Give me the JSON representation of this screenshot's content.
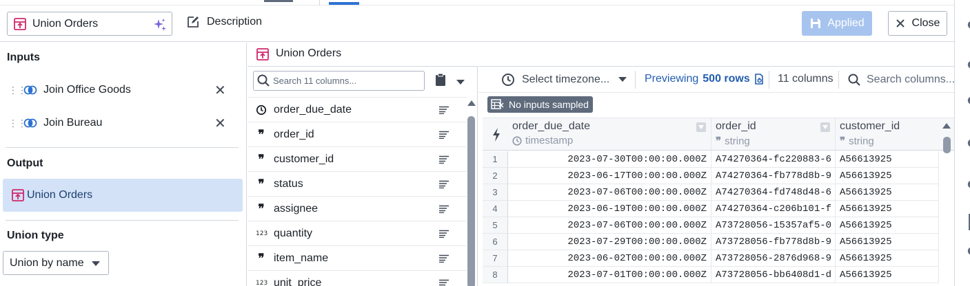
{
  "header": {
    "transform_name": "Union Orders",
    "description_label": "Description",
    "applied_label": "Applied",
    "close_label": "Close"
  },
  "left_panel": {
    "inputs_title": "Inputs",
    "inputs": [
      {
        "label": "Join Office Goods"
      },
      {
        "label": "Join Bureau"
      }
    ],
    "output_title": "Output",
    "output": {
      "label": "Union Orders"
    },
    "union_type_title": "Union type",
    "union_type_value": "Union by name"
  },
  "columns_panel": {
    "title": "Union Orders",
    "search_placeholder": "Search 11 columns...",
    "columns": [
      {
        "name": "order_due_date",
        "type_icon": "clock-icon"
      },
      {
        "name": "order_id",
        "type_icon": "quote-icon"
      },
      {
        "name": "customer_id",
        "type_icon": "quote-icon"
      },
      {
        "name": "status",
        "type_icon": "quote-icon"
      },
      {
        "name": "assignee",
        "type_icon": "quote-icon"
      },
      {
        "name": "quantity",
        "type_icon": "number-icon"
      },
      {
        "name": "item_name",
        "type_icon": "quote-icon"
      },
      {
        "name": "unit_price",
        "type_icon": "number-icon"
      }
    ],
    "quote_glyph": "❞",
    "number_glyph": "123"
  },
  "table_panel": {
    "timezone_placeholder": "Select timezone...",
    "preview_prefix": "Previewing",
    "preview_rows": "500 rows",
    "column_count": "11 columns",
    "column_search_placeholder": "Search columns...",
    "badge": "No inputs sampled",
    "headers": [
      {
        "name": "order_due_date",
        "type": "timestamp"
      },
      {
        "name": "order_id",
        "type": "string"
      },
      {
        "name": "customer_id",
        "type": "string"
      }
    ],
    "rows": [
      {
        "n": "1",
        "order_due_date": "2023-07-30T00:00:00.000Z",
        "order_id": "A74270364-fc220883-6",
        "customer_id": "A56613925"
      },
      {
        "n": "2",
        "order_due_date": "2023-06-17T00:00:00.000Z",
        "order_id": "A74270364-fb778d8b-9",
        "customer_id": "A56613925"
      },
      {
        "n": "3",
        "order_due_date": "2023-07-06T00:00:00.000Z",
        "order_id": "A74270364-fd748d48-6",
        "customer_id": "A56613925"
      },
      {
        "n": "4",
        "order_due_date": "2023-06-19T00:00:00.000Z",
        "order_id": "A74270364-c206b101-f",
        "customer_id": "A56613925"
      },
      {
        "n": "5",
        "order_due_date": "2023-07-06T00:00:00.000Z",
        "order_id": "A73728056-15357af5-0",
        "customer_id": "A56613925"
      },
      {
        "n": "6",
        "order_due_date": "2023-07-29T00:00:00.000Z",
        "order_id": "A73728056-fb778d8b-9",
        "customer_id": "A56613925"
      },
      {
        "n": "7",
        "order_due_date": "2023-06-02T00:00:00.000Z",
        "order_id": "A73728056-2876d968-9",
        "customer_id": "A56613925"
      },
      {
        "n": "8",
        "order_due_date": "2023-07-01T00:00:00.000Z",
        "order_id": "A73728056-bb6408d1-d",
        "customer_id": "A56613925"
      }
    ]
  },
  "colors": {
    "accent": "#2d72d2",
    "selected_bg": "#d3e2f7",
    "union_icon": "#d1286b",
    "applied_bg": "#a7c4ee"
  }
}
